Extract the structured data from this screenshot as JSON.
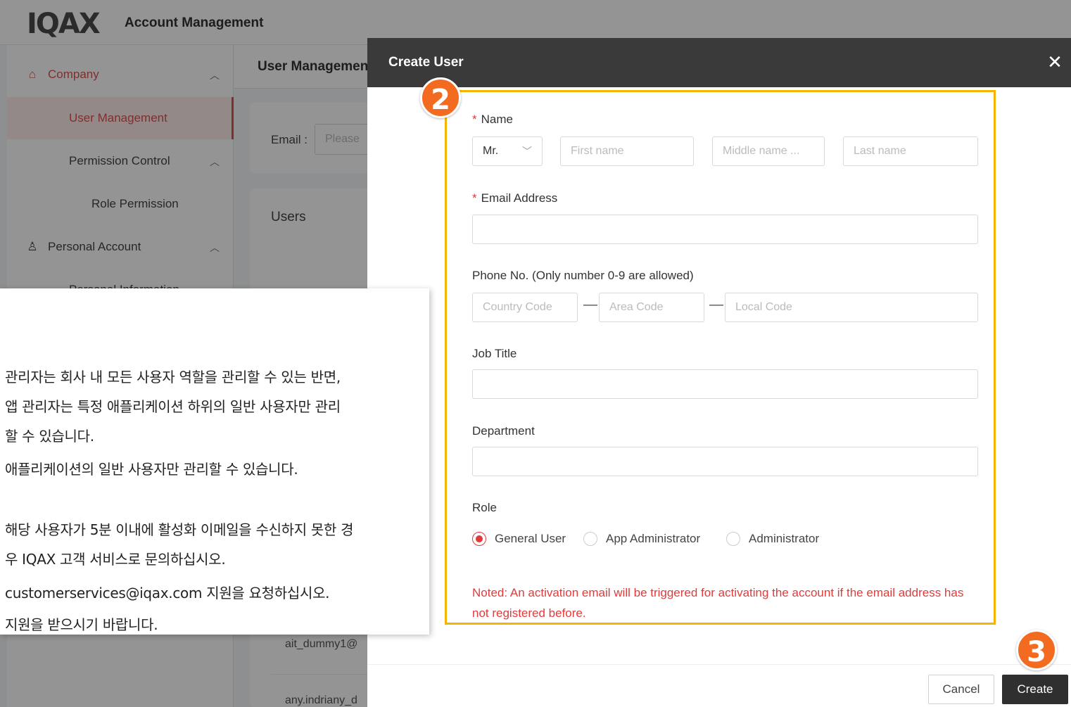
{
  "app": {
    "logo": "IQAX",
    "title": "Account Management"
  },
  "sidebar": {
    "items": [
      {
        "label": "Company",
        "icon": "home-icon"
      },
      {
        "label": "User Management"
      },
      {
        "label": "Permission Control"
      },
      {
        "label": "Role Permission"
      },
      {
        "label": "Personal Account",
        "icon": "user-icon"
      },
      {
        "label": "Personal Information"
      }
    ]
  },
  "content": {
    "title": "User Management",
    "filter": {
      "email_label": "Email :",
      "email_placeholder": "Please"
    },
    "users_title": "Users",
    "rows": [
      "ait_dummy1@",
      "any.indriany_d"
    ]
  },
  "modal": {
    "title": "Create User",
    "close_glyph": "✕",
    "name": {
      "label": "Name",
      "title_value": "Mr.",
      "first_placeholder": "First name",
      "middle_placeholder": "Middle name ...",
      "last_placeholder": "Last name"
    },
    "email": {
      "label": "Email Address",
      "value": ""
    },
    "phone": {
      "label": "Phone No. (Only number 0-9 are allowed)",
      "country_placeholder": "Country Code",
      "area_placeholder": "Area Code",
      "local_placeholder": "Local Code"
    },
    "job_title": {
      "label": "Job Title",
      "value": ""
    },
    "department": {
      "label": "Department",
      "value": ""
    },
    "role": {
      "label": "Role",
      "options": [
        "General User",
        "App Administrator",
        "Administrator"
      ],
      "selected": "General User"
    },
    "note": "Noted: An activation email will be triggered for activating the account if the email address has not registered before.",
    "buttons": {
      "cancel": "Cancel",
      "create": "Create"
    }
  },
  "steps": {
    "two": "2",
    "three": "3"
  },
  "callout": {
    "lines": [
      "관리자는 회사 내 모든 사용자 역할을 관리할 수 있는 반면,",
      "앱 관리자는 특정 애플리케이션 하위의 일반 사용자만 관리",
      "할 수 있습니다.",
      "애플리케이션의 일반 사용자만 관리할 수 있습니다.",
      "해당 사용자가 5분 이내에 활성화 이메일을 수신하지 못한 경",
      "우 IQAX 고객 서비스로 문의하십시오.",
      "customerservices@iqax.com 지원을 요청하십시오.",
      "지원을 받으시기 바랍니다."
    ]
  },
  "colors": {
    "accent_red": "#e03b3b",
    "highlight_yellow": "#f5b400",
    "step_orange": "#f26b21",
    "modal_header": "#3a3a3a"
  }
}
